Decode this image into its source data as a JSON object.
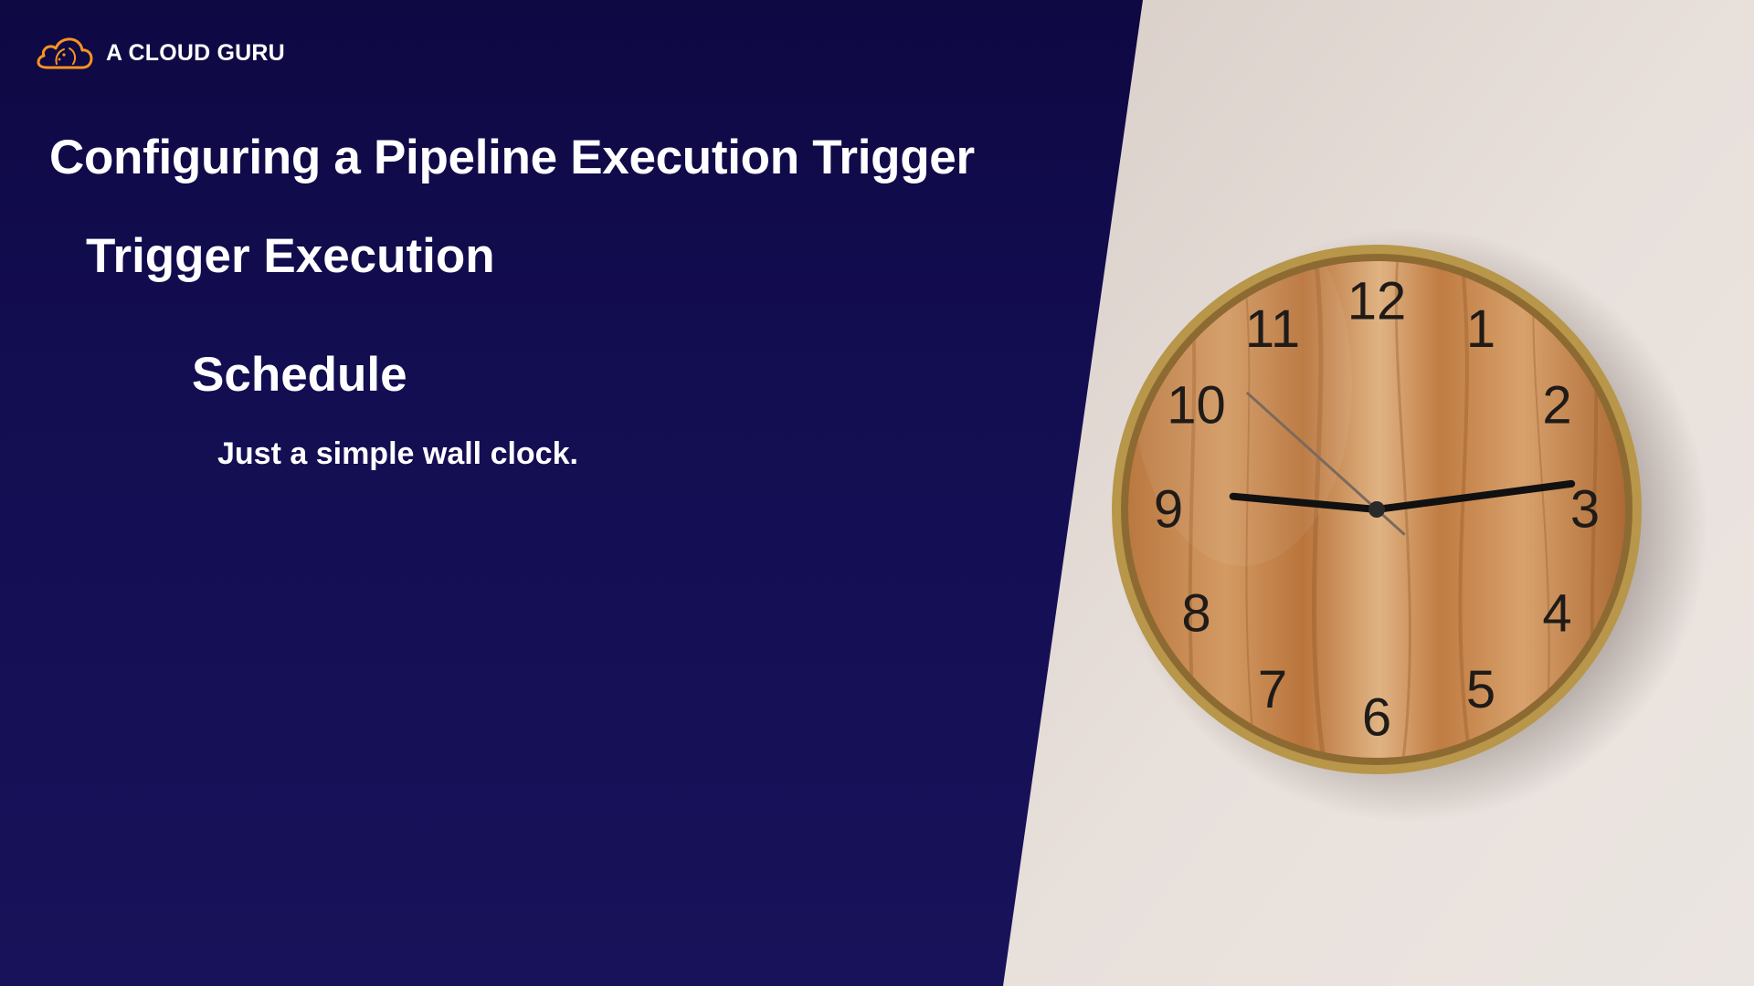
{
  "brand": {
    "name": "A CLOUD GURU",
    "accent_color": "#f79321",
    "logo_icon": "cloud-logo-icon"
  },
  "slide": {
    "title": "Configuring a Pipeline Execution Trigger",
    "heading": "Trigger Execution",
    "subheading": "Schedule",
    "body": "Just a simple wall clock."
  },
  "photo": {
    "subject": "wall-clock-icon",
    "clock_numerals": [
      "12",
      "1",
      "2",
      "3",
      "4",
      "5",
      "6",
      "7",
      "8",
      "9",
      "10",
      "11"
    ],
    "time_shown": {
      "hour": 2,
      "minute": 45,
      "second": 52
    },
    "colors": {
      "background_navy": "#130e52",
      "wall": "#e6ded9",
      "clock_face": "#c88a55",
      "clock_rim": "#b8964a",
      "numerals": "#1f1b18"
    }
  }
}
